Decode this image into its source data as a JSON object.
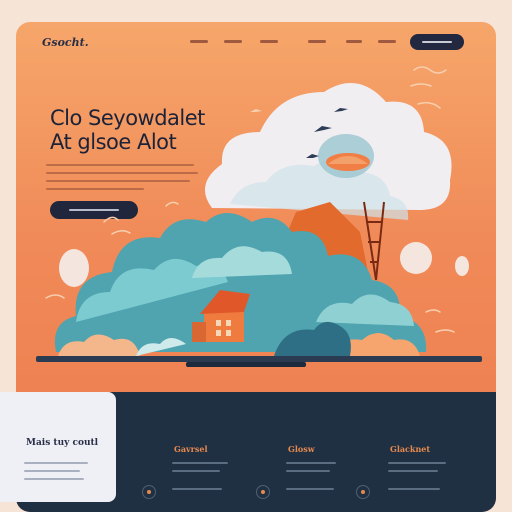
{
  "header": {
    "logo": "Gsocht.",
    "nav_links": [
      "",
      "",
      "",
      "",
      ""
    ],
    "cta_button": ""
  },
  "hero": {
    "title_line1": "Clo Seyowdalet",
    "title_line2": "At glsoe Alot",
    "cta_button": ""
  },
  "footer": {
    "card_title": "Mais tuy coutl",
    "columns": [
      {
        "title": "Gavrsel"
      },
      {
        "title": "Glosw"
      },
      {
        "title": "Glacknet"
      }
    ]
  },
  "colors": {
    "background": "#f08a58",
    "dark": "#1f3042",
    "accent": "#e7894f",
    "teal": "#5fb8c0"
  }
}
